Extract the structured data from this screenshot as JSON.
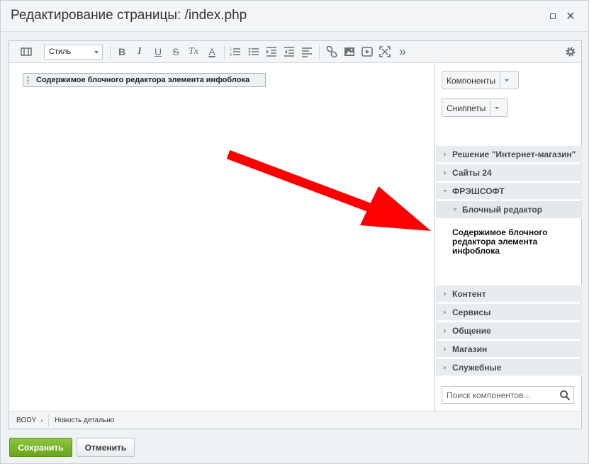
{
  "dialog": {
    "title": "Редактирование страницы: /index.php",
    "maximize_icon": "maximize-icon",
    "close_icon": "close-icon",
    "close_glyph": "✕"
  },
  "toolbar": {
    "style_select_value": "Стиль",
    "icons": [
      "view-mode-icon",
      "bold-icon",
      "italic-icon",
      "underline-icon",
      "strikethrough-icon",
      "remove-format-icon",
      "text-color-icon",
      "ordered-list-icon",
      "unordered-list-icon",
      "indent-icon",
      "outdent-icon",
      "align-icon",
      "link-icon",
      "image-icon",
      "video-icon",
      "fullscreen-icon",
      "more-icon",
      "settings-icon"
    ],
    "glyphs": {
      "bold": "B",
      "italic": "I",
      "underline": "U",
      "strike": "S",
      "clear": "Tx",
      "color": "A",
      "more": "»"
    }
  },
  "content": {
    "block_label": "Содержимое блочного редактора элемента инфоблока"
  },
  "sidebar": {
    "components_button": "Компоненты",
    "snippets_button": "Сниппеты",
    "categories_top": [
      {
        "label": "Решение \"Интернет-магазин\""
      },
      {
        "label": "Сайты 24"
      },
      {
        "label": "ФРЭШСОФТ"
      }
    ],
    "subcategory": "Блочный редактор",
    "component_item": "Содержимое блочного редактора элемента инфоблока",
    "categories_bottom": [
      {
        "label": "Контент"
      },
      {
        "label": "Сервисы"
      },
      {
        "label": "Общение"
      },
      {
        "label": "Магазин"
      },
      {
        "label": "Служебные"
      }
    ],
    "search_placeholder": "Поиск компонентов...",
    "search_icon": "search-icon"
  },
  "statusbar": {
    "crumb_body": "BODY",
    "crumb_template": "Новость детально"
  },
  "footer": {
    "save_label": "Сохранить",
    "cancel_label": "Отменить"
  },
  "colors": {
    "annotation_arrow": "#ff0000",
    "save_button": "#76b02b"
  }
}
